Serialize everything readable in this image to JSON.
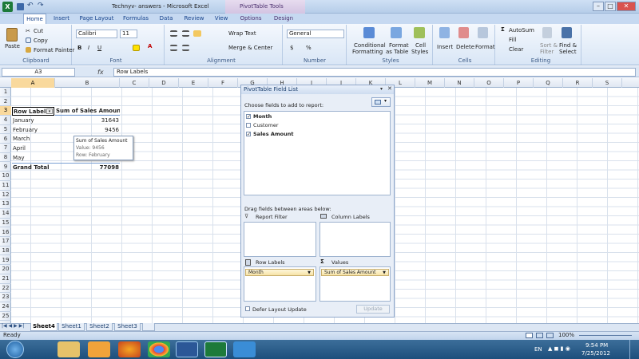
{
  "window": {
    "title": "Technyv- answers - Microsoft Excel",
    "context_tab": "PivotTable Tools"
  },
  "tabs": [
    "Home",
    "Insert",
    "Page Layout",
    "Formulas",
    "Data",
    "Review",
    "View",
    "Options",
    "Design"
  ],
  "ribbon": {
    "clipboard": {
      "label": "Clipboard",
      "paste": "Paste",
      "cut": "Cut",
      "copy": "Copy",
      "format_painter": "Format Painter"
    },
    "font": {
      "label": "Font",
      "name": "Calibri",
      "size": "11"
    },
    "alignment": {
      "label": "Alignment",
      "wrap": "Wrap Text",
      "merge": "Merge & Center"
    },
    "number": {
      "label": "Number",
      "format": "General",
      "currency": "$",
      "percent": "%"
    },
    "styles": {
      "label": "Styles",
      "cond": "Conditional",
      "cond2": "Formatting",
      "fmt_table": "Format",
      "fmt_table2": "as Table",
      "cell_styles": "Cell",
      "cell_styles2": "Styles"
    },
    "cells": {
      "label": "Cells",
      "insert": "Insert",
      "delete": "Delete",
      "format": "Format"
    },
    "editing": {
      "label": "Editing",
      "autosum": "AutoSum",
      "fill": "Fill",
      "clear": "Clear",
      "sort": "Sort &",
      "sort2": "Filter",
      "find": "Find &",
      "find2": "Select"
    }
  },
  "formula": {
    "name_box": "A3",
    "fx": "fx",
    "value": "Row Labels"
  },
  "columns": [
    "A",
    "B",
    "C",
    "D",
    "E",
    "F",
    "G",
    "H",
    "I",
    "J",
    "K",
    "L",
    "M",
    "N",
    "O",
    "P",
    "Q",
    "R",
    "S"
  ],
  "rows": [
    "1",
    "2",
    "3",
    "4",
    "5",
    "6",
    "7",
    "8",
    "9",
    "10",
    "11",
    "12",
    "13",
    "14",
    "15",
    "16",
    "17",
    "18",
    "19",
    "20",
    "21",
    "22",
    "23",
    "24",
    "25"
  ],
  "pivot": {
    "header_labels": "Row Labels",
    "header_values": "Sum of Sales Amount",
    "rows": [
      {
        "label": "January",
        "value": "31643"
      },
      {
        "label": "February",
        "value": "9456"
      },
      {
        "label": "March",
        "value": ""
      },
      {
        "label": "April",
        "value": ""
      },
      {
        "label": "May",
        "value": ""
      }
    ],
    "total_label": "Grand Total",
    "total_value": "77098"
  },
  "tooltip": {
    "line1": "Sum of Sales Amount",
    "line2": "Value: 9456",
    "line3": "Row: February"
  },
  "field_list": {
    "title": "PivotTable Field List",
    "choose": "Choose fields to add to report:",
    "fields": [
      {
        "name": "Month",
        "checked": true
      },
      {
        "name": "Customer",
        "checked": false
      },
      {
        "name": "Sales Amount",
        "checked": true
      }
    ],
    "drag": "Drag fields between areas below:",
    "report_filter": "Report Filter",
    "column_labels": "Column Labels",
    "row_labels": "Row Labels",
    "values": "Values",
    "row_item": "Month",
    "value_item": "Sum of Sales Amount",
    "defer": "Defer Layout Update",
    "update": "Update"
  },
  "sheets": [
    "Sheet4",
    "Sheet1",
    "Sheet2",
    "Sheet3"
  ],
  "status": {
    "ready": "Ready",
    "zoom": "100%"
  },
  "taskbar": {
    "lang": "EN",
    "time": "9:54 PM",
    "date": "7/25/2012"
  }
}
